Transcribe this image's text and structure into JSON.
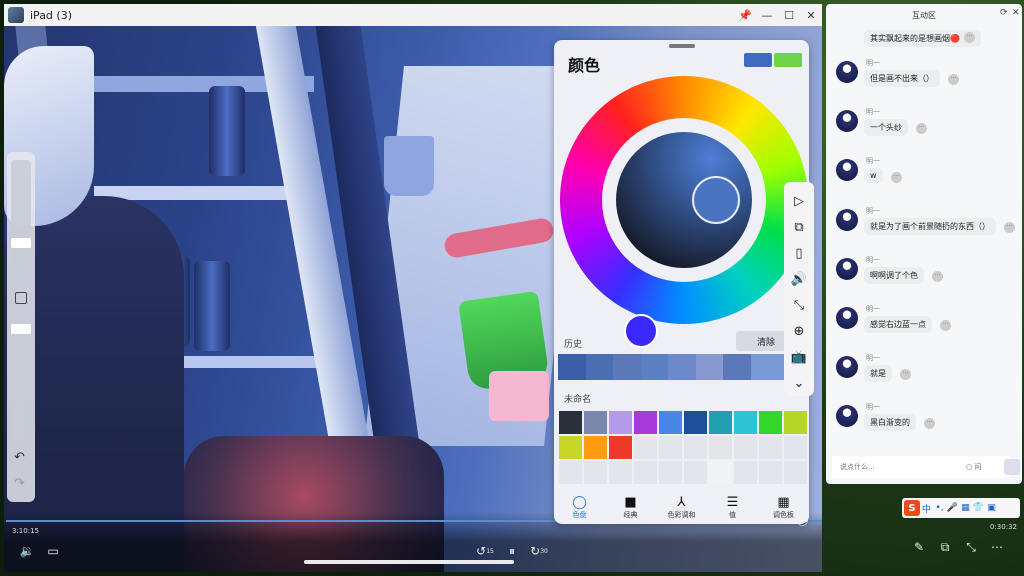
{
  "window": {
    "title": "iPad (3)"
  },
  "titlebar_buttons": [
    "pin-icon",
    "minimize-icon",
    "maximize-icon",
    "close-icon"
  ],
  "color_panel": {
    "title": "颜色",
    "primary_color": "#3f6bbf",
    "secondary_color": "#6ed24b",
    "history_label": "历史",
    "clear_label": "清除",
    "history_colors": [
      "#3a5fa8",
      "#4b6fb4",
      "#5c78b8",
      "#5c80c6",
      "#6d89cc",
      "#8699d0",
      "#5c78b8",
      "#7a97d6",
      "#7a97d6"
    ],
    "palette_label": "未命名",
    "palette_colors": [
      "#2b2f3a",
      "#7b88ad",
      "#b69be8",
      "#a73ad8",
      "#4a86e8",
      "#1e4f9a",
      "#20a0b0",
      "#2ec3d4",
      "#33d62a",
      "#b6d62a",
      "#c8d62a",
      "#ff9c0f",
      "#ee3a2a",
      "#e3e5ea",
      "#e3e5ea",
      "#e3e5ea",
      "#e3e5ea",
      "#e3e5ea",
      "#e3e5ea",
      "#e3e5ea",
      "#e3e5ea",
      "#e3e5ea",
      "#e3e5ea",
      "#e3e5ea",
      "#e3e5ea",
      "#e3e5ea",
      "#f1f2f4",
      "#e3e5ea",
      "#e3e5ea",
      "#e3e5ea"
    ],
    "tabs": [
      {
        "label": "色盘",
        "icon": "disc-icon",
        "glyph": "◯"
      },
      {
        "label": "经典",
        "icon": "square-icon",
        "glyph": "■"
      },
      {
        "label": "色彩调和",
        "icon": "harmony-icon",
        "glyph": "⅄"
      },
      {
        "label": "值",
        "icon": "sliders-icon",
        "glyph": "☰"
      },
      {
        "label": "调色板",
        "icon": "grid-icon",
        "glyph": "▦"
      }
    ]
  },
  "side_tools": [
    {
      "icon": "video-play-icon",
      "glyph": "▷"
    },
    {
      "icon": "screenshot-icon",
      "glyph": "⧉"
    },
    {
      "icon": "phone-rotate-icon",
      "glyph": "▯"
    },
    {
      "icon": "volume-icon",
      "glyph": "🔊"
    },
    {
      "icon": "fullscreen-icon",
      "glyph": "⤡"
    },
    {
      "icon": "zoom-in-icon",
      "glyph": "⊕"
    },
    {
      "icon": "tv-icon",
      "glyph": "📺"
    },
    {
      "icon": "chevron-down-icon",
      "glyph": "⌄"
    }
  ],
  "player": {
    "time_left": "3:10:15",
    "time_right": "0:30:32",
    "progress": 0.92,
    "rewind_label": "15",
    "forward_label": "30"
  },
  "chat": {
    "title": "互动区",
    "input_placeholder": "说点什么...",
    "question_label": "问",
    "first_bubble": "其实飘起来的是想画烟🔴",
    "messages": [
      {
        "name": "明一",
        "text": "但是画不出来（）"
      },
      {
        "name": "明一",
        "text": "一个头纱"
      },
      {
        "name": "明一",
        "text": "w"
      },
      {
        "name": "明一",
        "text": "就是为了画个前景随扔的东西（）"
      },
      {
        "name": "明一",
        "text": "啊啊调了个色"
      },
      {
        "name": "明一",
        "text": "感觉右边蓝一点"
      },
      {
        "name": "明一",
        "text": "就是"
      },
      {
        "name": "明一",
        "text": "黑白渐变的"
      }
    ]
  },
  "ime": {
    "logo": "S",
    "items": [
      "中",
      "•,",
      "🎤",
      "▦",
      "👕",
      "▣"
    ]
  }
}
